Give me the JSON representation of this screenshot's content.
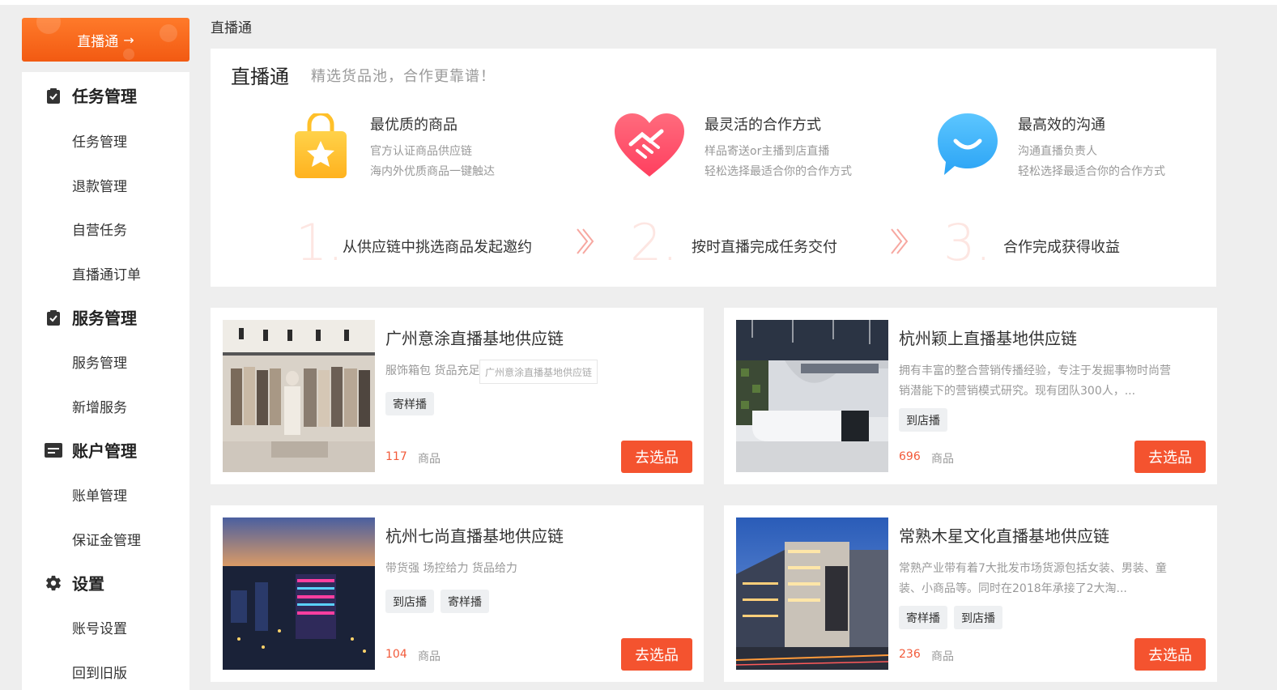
{
  "sidebar": {
    "top_button": "直播通",
    "sections": [
      {
        "label": "任务管理",
        "items": [
          "任务管理",
          "退款管理",
          "自营任务",
          "直播通订单"
        ]
      },
      {
        "label": "服务管理",
        "items": [
          "服务管理",
          "新增服务"
        ]
      },
      {
        "label": "账户管理",
        "items": [
          "账单管理",
          "保证金管理"
        ]
      },
      {
        "label": "设置",
        "items": [
          "账号设置",
          "回到旧版"
        ]
      }
    ]
  },
  "breadcrumb": "直播通",
  "intro": {
    "title": "直播通",
    "subtitle": "精选货品池，合作更靠谱！",
    "features": [
      {
        "title": "最优质的商品",
        "lines": [
          "官方认证商品供应链",
          "海内外优质商品一键触达"
        ]
      },
      {
        "title": "最灵活的合作方式",
        "lines": [
          "样品寄送or主播到店直播",
          "轻松选择最适合你的合作方式"
        ]
      },
      {
        "title": "最高效的沟通",
        "lines": [
          "沟通直播负责人",
          "轻松选择最适合你的合作方式"
        ]
      }
    ],
    "steps": [
      {
        "num": "1.",
        "text": "从供应链中挑选商品发起邀约"
      },
      {
        "num": "2.",
        "text": "按时直播完成任务交付"
      },
      {
        "num": "3.",
        "text": "合作完成获得收益"
      }
    ]
  },
  "cards": [
    {
      "name": "广州意涂直播基地供应链",
      "desc": "服饰箱包 货品充足",
      "tooltip": "广州意涂直播基地供应链",
      "tags": [
        "寄样播"
      ],
      "count": "117",
      "unit": "商品",
      "button": "去选品"
    },
    {
      "name": "杭州颖上直播基地供应链",
      "desc": "拥有丰富的整合营销传播经验，专注于发掘事物时尚营销潜能下的营销模式研究。现有团队300人，...",
      "tags": [
        "到店播"
      ],
      "count": "696",
      "unit": "商品",
      "button": "去选品"
    },
    {
      "name": "杭州七尚直播基地供应链",
      "desc": "带货强 场控给力 货品给力",
      "tags": [
        "到店播",
        "寄样播"
      ],
      "count": "104",
      "unit": "商品",
      "button": "去选品"
    },
    {
      "name": "常熟木星文化直播基地供应链",
      "desc": "常熟产业带有着7大批发市场货源包括女装、男装、童装、小商品等。同时在2018年承接了2大淘...",
      "tags": [
        "寄样播",
        "到店播"
      ],
      "count": "236",
      "unit": "商品",
      "button": "去选品"
    }
  ],
  "colors": {
    "accent": "#f4532f",
    "orange": "#f76a1f"
  }
}
